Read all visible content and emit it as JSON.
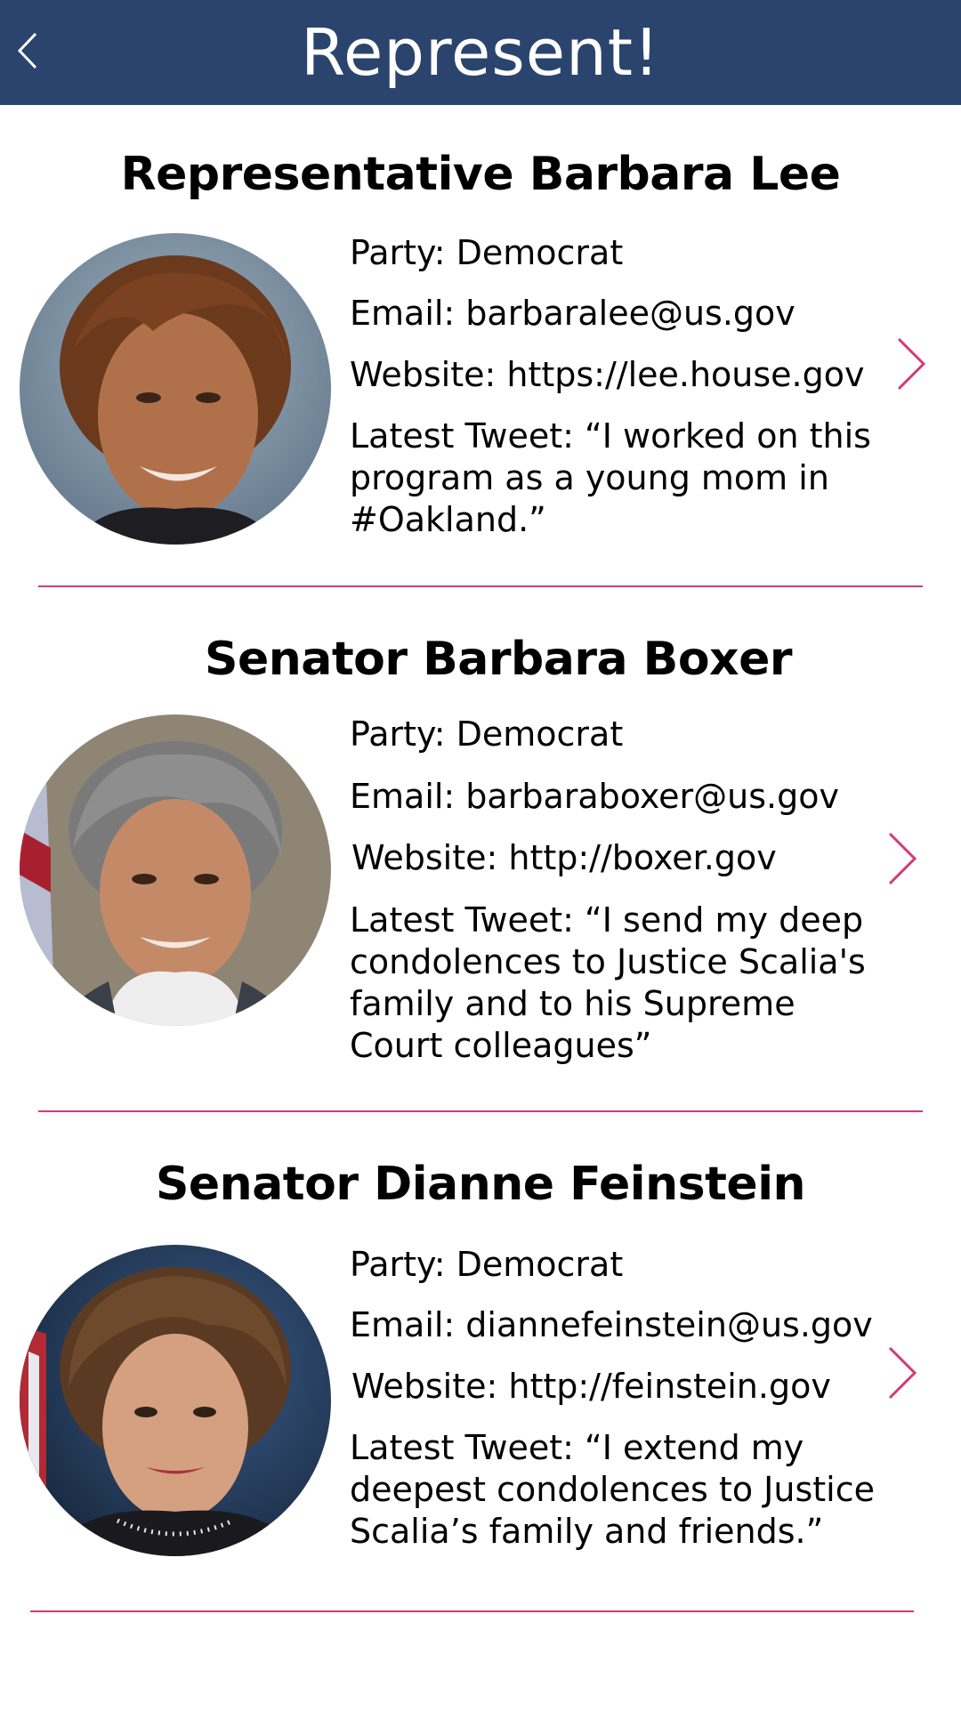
{
  "app": {
    "title": "Represent!",
    "header_color": "#2a446d",
    "accent_color": "#cf3d77",
    "back_icon": "chevron-left-icon",
    "detail_icon": "chevron-right-icon"
  },
  "representatives": [
    {
      "name": "Representative Barbara Lee",
      "party": "Party: Democrat",
      "email": "Email: barbaralee@us.gov",
      "website": "Website: https://lee.house.gov",
      "tweet": "Latest Tweet: “I worked on this program as a young mom in #Oakland.”"
    },
    {
      "name": "Senator Barbara Boxer",
      "party": "Party: Democrat",
      "email": "Email: barbaraboxer@us.gov",
      "website": "Website: http://boxer.gov",
      "tweet": "Latest Tweet: “I send my deep condolences to Justice Scalia's family and to his Supreme Court colleagues”"
    },
    {
      "name": "Senator Dianne Feinstein",
      "party": "Party: Democrat",
      "email": "Email: diannefeinstein@us.gov",
      "website": "Website: http://feinstein.gov",
      "tweet": "Latest Tweet: “I extend my deepest condolences to Justice Scalia’s family and friends.”"
    }
  ]
}
